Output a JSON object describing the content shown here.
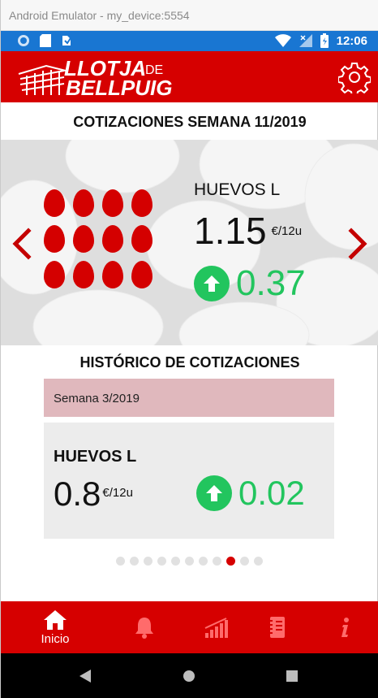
{
  "window": {
    "title": "Android Emulator - my_device:5554"
  },
  "statusbar": {
    "time": "12:06"
  },
  "app": {
    "logo_line1": "LLOTJA",
    "logo_de": "DE",
    "logo_line2": "BELLPUIG"
  },
  "colors": {
    "brand": "#d60000",
    "positive": "#22c55e",
    "statusbar": "#1976d2",
    "week_box": "#e0b8bd"
  },
  "main": {
    "week_title": "COTIZACIONES SEMANA 11/2019",
    "product": {
      "name": "HUEVOS L",
      "price": "1.15",
      "unit": "€/12u",
      "change": "0.37",
      "change_icon": "arrow-up-circle-icon"
    }
  },
  "history": {
    "title": "HISTÓRICO DE COTIZACIONES",
    "week_label": "Semana  3/2019",
    "card": {
      "name": "HUEVOS L",
      "price": "0.8",
      "unit": "€/12u",
      "change": "0.02"
    },
    "pager": {
      "total": 11,
      "active_index": 8
    }
  },
  "bottom_nav": {
    "items": [
      {
        "label": "Inicio",
        "icon": "home-icon"
      },
      {
        "label": "",
        "icon": "bell-icon"
      },
      {
        "label": "",
        "icon": "chart-icon"
      },
      {
        "label": "",
        "icon": "notebook-icon"
      },
      {
        "label": "",
        "icon": "info-icon"
      }
    ]
  }
}
